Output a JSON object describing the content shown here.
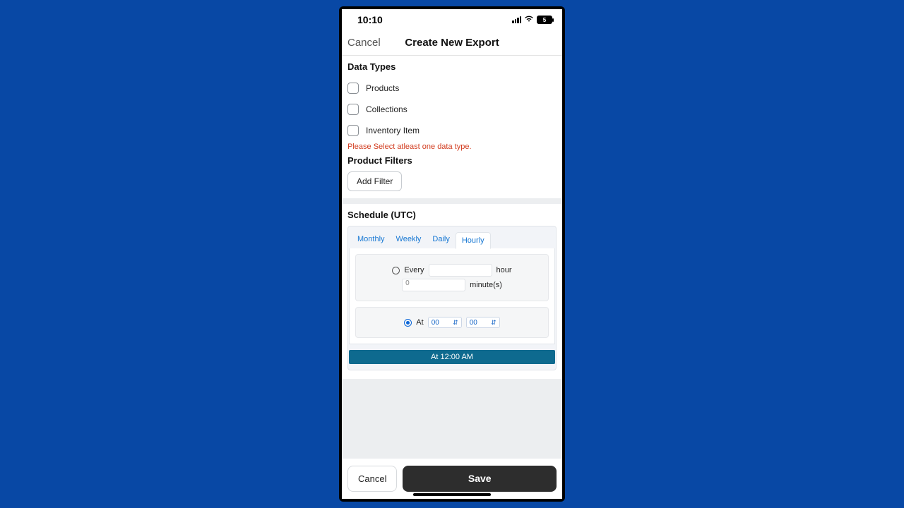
{
  "statusbar": {
    "time": "10:10",
    "battery": "5"
  },
  "header": {
    "cancel": "Cancel",
    "title": "Create New Export"
  },
  "dataTypes": {
    "title": "Data Types",
    "items": [
      "Products",
      "Collections",
      "Inventory Item"
    ],
    "error": "Please Select atleast one data type."
  },
  "productFilters": {
    "title": "Product Filters",
    "addFilter": "Add Filter"
  },
  "schedule": {
    "title": "Schedule (UTC)",
    "tabs": [
      "Monthly",
      "Weekly",
      "Daily",
      "Hourly"
    ],
    "activeTab": "Hourly",
    "every": {
      "label": "Every",
      "unit": "hour",
      "minutesUnit": "minute(s)",
      "minutesPlaceholder": "0"
    },
    "at": {
      "label": "At",
      "hour": "00",
      "minute": "00"
    },
    "summary": "At 12:00 AM"
  },
  "footer": {
    "cancel": "Cancel",
    "save": "Save"
  }
}
